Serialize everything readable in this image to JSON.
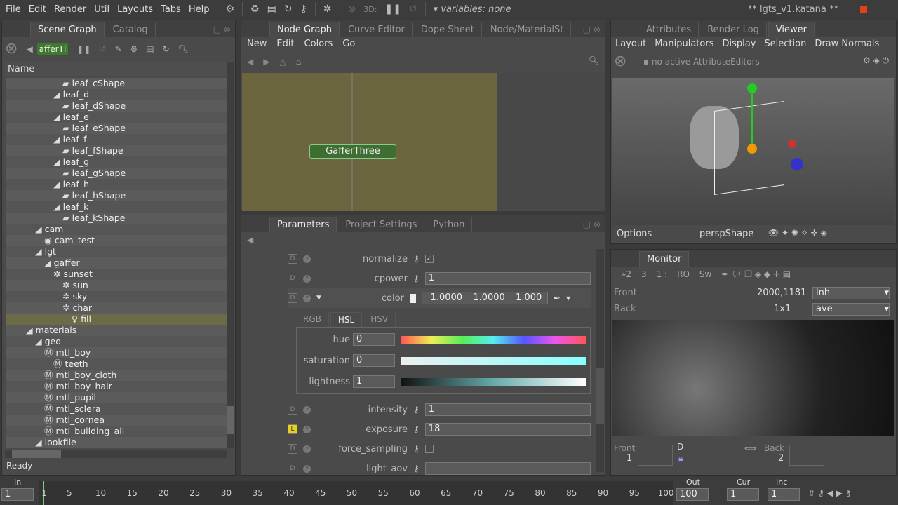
{
  "menubar": {
    "items": [
      "File",
      "Edit",
      "Render",
      "Util",
      "Layouts",
      "Tabs",
      "Help"
    ],
    "threed": "3D:",
    "variables": "variables: none",
    "title": "** lgts_v1.katana **"
  },
  "scenegraph": {
    "tabs": [
      "Scene Graph",
      "Catalog"
    ],
    "node": "afferTl",
    "column": "Name",
    "status": "Ready",
    "items": [
      {
        "label": "leaf_cShape",
        "d": 4
      },
      {
        "label": "leaf_d",
        "d": 3
      },
      {
        "label": "leaf_dShape",
        "d": 4
      },
      {
        "label": "leaf_e",
        "d": 3
      },
      {
        "label": "leaf_eShape",
        "d": 4
      },
      {
        "label": "leaf_f",
        "d": 3
      },
      {
        "label": "leaf_fShape",
        "d": 4
      },
      {
        "label": "leaf_g",
        "d": 3
      },
      {
        "label": "leaf_gShape",
        "d": 4
      },
      {
        "label": "leaf_h",
        "d": 3
      },
      {
        "label": "leaf_hShape",
        "d": 4
      },
      {
        "label": "leaf_k",
        "d": 3
      },
      {
        "label": "leaf_kShape",
        "d": 4
      },
      {
        "label": "cam",
        "d": 1
      },
      {
        "label": "cam_test",
        "d": 2
      },
      {
        "label": "lgt",
        "d": 1
      },
      {
        "label": "gaffer",
        "d": 2
      },
      {
        "label": "sunset",
        "d": 3
      },
      {
        "label": "sun",
        "d": 4
      },
      {
        "label": "sky",
        "d": 4
      },
      {
        "label": "char",
        "d": 4
      },
      {
        "label": "fill",
        "d": 5,
        "selected": true
      },
      {
        "label": "materials",
        "d": 0
      },
      {
        "label": "geo",
        "d": 1
      },
      {
        "label": "mtl_boy",
        "d": 2
      },
      {
        "label": "teeth",
        "d": 3
      },
      {
        "label": "mtl_boy_cloth",
        "d": 2
      },
      {
        "label": "mtl_boy_hair",
        "d": 2
      },
      {
        "label": "mtl_pupil",
        "d": 2
      },
      {
        "label": "mtl_sclera",
        "d": 2
      },
      {
        "label": "mtl_cornea",
        "d": 2
      },
      {
        "label": "mtl_building_all",
        "d": 2
      },
      {
        "label": "lookfile",
        "d": 1
      }
    ]
  },
  "nodegraph": {
    "tabs": [
      "Node Graph",
      "Curve Editor",
      "Dope Sheet",
      "Node/MaterialSt"
    ],
    "menu": [
      "New",
      "Edit",
      "Colors",
      "Go"
    ],
    "node": "GafferThree",
    "bg": "#6b6540"
  },
  "params": {
    "tabs": [
      "Parameters",
      "Project Settings",
      "Python"
    ],
    "rows1": [
      {
        "label": "normalize",
        "type": "check",
        "value": true
      },
      {
        "label": "cpower",
        "value": "1"
      }
    ],
    "color": {
      "label": "color",
      "r": "1.0000",
      "g": "1.0000",
      "b": "1.000"
    },
    "color_tabs": [
      "RGB",
      "HSL",
      "HSV"
    ],
    "hsl": [
      {
        "label": "hue",
        "value": "0"
      },
      {
        "label": "saturation",
        "value": "0"
      },
      {
        "label": "lightness",
        "value": "1"
      }
    ],
    "rows2": [
      {
        "label": "intensity",
        "value": "1",
        "flag": "D"
      },
      {
        "label": "exposure",
        "value": "18",
        "flag": "L"
      },
      {
        "label": "force_sampling",
        "type": "check",
        "value": false,
        "flag": "D"
      },
      {
        "label": "light_aov",
        "value": "",
        "flag": "D"
      }
    ]
  },
  "viewer": {
    "tabs": [
      "Attributes",
      "Render Log",
      "Viewer"
    ],
    "menu": [
      "Layout",
      "Manipulators",
      "Display",
      "Selection",
      "Draw Normals"
    ],
    "attr_msg": "no active AttributeEditors",
    "options": "Options",
    "camera": "perspShape"
  },
  "monitor": {
    "tab": "Monitor",
    "toolbar": [
      "»2",
      "3",
      "1 :",
      "RO",
      "Sw"
    ],
    "front": "Front",
    "back": "Back",
    "res": "2000,1181",
    "pixel": "1x1",
    "front_sel": "lnh",
    "back_sel": "ave",
    "front_num": "1",
    "back_num": "2",
    "d_label": "D"
  },
  "timeline": {
    "in_label": "In",
    "in": "1",
    "out_label": "Out",
    "out": "100",
    "cur_label": "Cur",
    "cur": "1",
    "inc_label": "Inc",
    "inc": "1",
    "ticks": [
      "1",
      "5",
      "10",
      "15",
      "20",
      "25",
      "30",
      "35",
      "40",
      "45",
      "50",
      "55",
      "60",
      "65",
      "70",
      "75",
      "80",
      "85",
      "90",
      "95",
      "100"
    ]
  }
}
